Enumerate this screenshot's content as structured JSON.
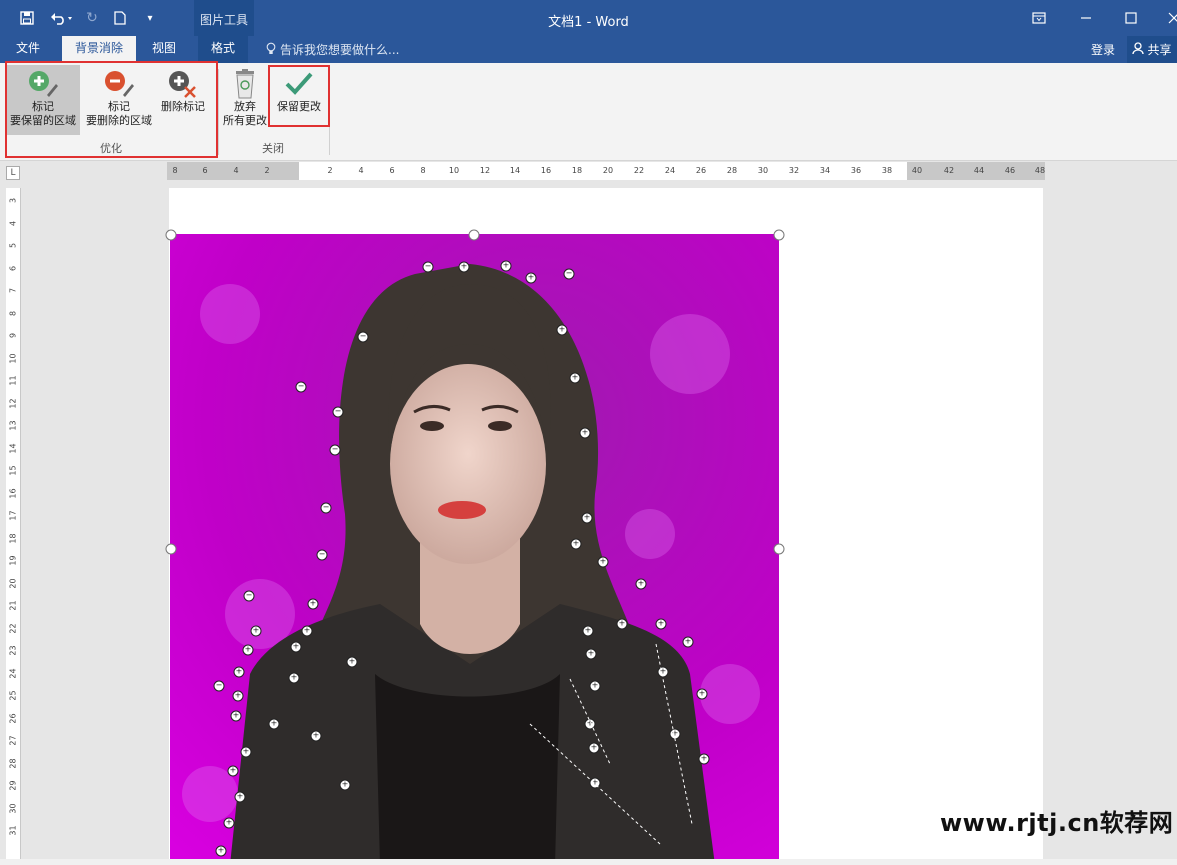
{
  "titlebar": {
    "title": "文档1 - Word",
    "context_group": "图片工具",
    "quick_access": [
      "save-icon",
      "undo-icon",
      "redo-icon",
      "new-document-icon",
      "customize-icon"
    ],
    "window_controls": [
      "ribbon-display-icon",
      "minimize-icon",
      "maximize-icon",
      "close-icon"
    ]
  },
  "tabs": [
    {
      "label": "文件",
      "active": false
    },
    {
      "label": "背景消除",
      "active": true
    },
    {
      "label": "视图",
      "active": false
    },
    {
      "label": "格式",
      "active": false
    }
  ],
  "tellme": "告诉我您想要做什么...",
  "login": "登录",
  "share": "共享",
  "ribbon": {
    "mark_keep": {
      "line1": "标记",
      "line2": "要保留的区域"
    },
    "mark_remove": {
      "line1": "标记",
      "line2": "要删除的区域"
    },
    "delete_mark": {
      "line1": "删除标记"
    },
    "discard": {
      "line1": "放弃",
      "line2": "所有更改"
    },
    "keep_changes": {
      "line1": "保留更改"
    },
    "group_refine": "优化",
    "group_close": "关闭"
  },
  "ruler": {
    "h_ticks": [
      "8",
      "6",
      "4",
      "2",
      "2",
      "4",
      "6",
      "8",
      "10",
      "12",
      "14",
      "16",
      "18",
      "20",
      "22",
      "24",
      "26",
      "28",
      "30",
      "32",
      "34",
      "36",
      "38",
      "40",
      "42",
      "44",
      "46",
      "48"
    ],
    "v_ticks": [
      "3",
      "4",
      "5",
      "6",
      "7",
      "8",
      "9",
      "10",
      "11",
      "12",
      "13",
      "14",
      "15",
      "16",
      "17",
      "18",
      "19",
      "20",
      "21",
      "22",
      "23",
      "24",
      "25",
      "26",
      "27",
      "28",
      "29",
      "30",
      "31"
    ],
    "corner": "L"
  },
  "watermark": "www.rjtj.cn软荐网",
  "colors": {
    "brand": "#2b579a",
    "highlight": "#e03131",
    "removed_area": "#c000c8"
  }
}
